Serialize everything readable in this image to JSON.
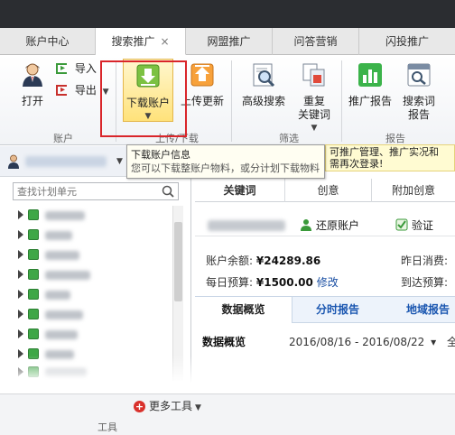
{
  "tabs": [
    {
      "label": "账户中心",
      "active": false
    },
    {
      "label": "搜索推广",
      "active": true
    },
    {
      "label": "网盟推广",
      "active": false
    },
    {
      "label": "问答营销",
      "active": false
    },
    {
      "label": "闪投推广",
      "active": false
    }
  ],
  "tab_close_glyph": "×",
  "ribbon": {
    "open_label": "打开",
    "import_label": "导入",
    "export_label": "导出",
    "download_label": "下载账户",
    "upload_label": "上传更新",
    "advanced_search_label": "高级搜索",
    "dedupe_label_1": "重复",
    "dedupe_label_2": "关键词",
    "report_label": "推广报告",
    "search_word_label_1": "搜索词",
    "search_word_label_2": "报告",
    "group_account": "账户",
    "group_upload_download": "上传/下载",
    "group_filter": "筛选",
    "group_report": "报告"
  },
  "tooltip": {
    "title": "下载账户信息",
    "desc": "您可以下载整账户物料，或分计划下载物料"
  },
  "banner": {
    "line1": "可推广管理、推广实况和",
    "line2": "需再次登录!"
  },
  "left": {
    "search_placeholder": "查找计划单元"
  },
  "right": {
    "tabs": [
      "关键词",
      "创意",
      "附加创意"
    ],
    "restore_label": "还原账户",
    "verify_label": "验证",
    "balance_label": "账户余额:",
    "balance_value": "¥24289.86",
    "yesterday_label": "昨日消费:",
    "budget_label": "每日预算:",
    "budget_value": "¥1500.00",
    "edit_label": "修改",
    "arrive_label": "到达预算:",
    "data_tabs": [
      "数据概览",
      "分时报告",
      "地域报告"
    ],
    "overview_title": "数据概览",
    "date_range": "2016/08/16 - 2016/08/22",
    "date_caret": "▾",
    "all_label": "全"
  },
  "bottom": {
    "more_tools": "更多工具",
    "tools_group": "工具"
  },
  "colors": {
    "highlight": "#d9252a",
    "link_blue": "#1a56b0",
    "folder_green": "#3fa747"
  }
}
